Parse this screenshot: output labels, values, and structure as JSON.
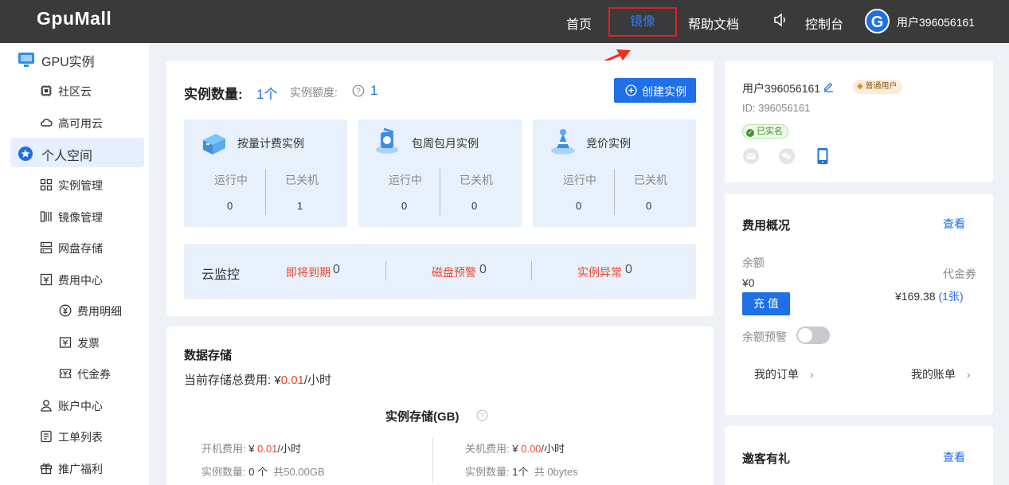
{
  "topbar": {
    "logo": "GpuMall",
    "nav": {
      "home": "首页",
      "mirror": "镜像",
      "docs": "帮助文档",
      "console": "控制台"
    },
    "user": "用户396056161",
    "avatar_letter": "G"
  },
  "sidebar": {
    "gpu_instance": "GPU实例",
    "community_cloud": "社区云",
    "ha_cloud": "高可用云",
    "personal_space": "个人空间",
    "instance_manage": "实例管理",
    "mirror_manage": "镜像管理",
    "disk_storage": "网盘存储",
    "fee_center": "费用中心",
    "fee_detail": "费用明细",
    "invoice": "发票",
    "voucher": "代金券",
    "account_center": "账户中心",
    "ticket_list": "工单列表",
    "promo": "推广福利"
  },
  "instances": {
    "count_label": "实例数量:",
    "count_value": "1个",
    "quota_label": "实例额度:",
    "quota_value": "1",
    "create_button": "创建实例",
    "cards": [
      {
        "title": "按量计费实例",
        "running_label": "运行中",
        "stopped_label": "已关机",
        "running": "0",
        "stopped": "1"
      },
      {
        "title": "包周包月实例",
        "running_label": "运行中",
        "stopped_label": "已关机",
        "running": "0",
        "stopped": "0"
      },
      {
        "title": "竞价实例",
        "running_label": "运行中",
        "stopped_label": "已关机",
        "running": "0",
        "stopped": "0"
      }
    ],
    "monitor": {
      "title": "云监控",
      "expiring_label": "即将到期",
      "expiring_value": "0",
      "disk_label": "磁盘预警",
      "disk_value": "0",
      "abnormal_label": "实例异常",
      "abnormal_value": "0"
    }
  },
  "storage": {
    "title": "数据存储",
    "total_label": "当前存储总费用:",
    "currency": "¥",
    "total_value": "0.01",
    "unit": "/小时",
    "instance_storage_title": "实例存储(GB)",
    "on_fee_label": "开机费用:",
    "on_fee_value": "0.01",
    "off_fee_label": "关机费用:",
    "off_fee_value": "0.00",
    "on_count_label": "实例数量:",
    "on_count_value": "0 个",
    "on_total": "共50.00GB",
    "off_count_label": "实例数量:",
    "off_count_value": "1个",
    "off_total": "共 0bytes"
  },
  "profile": {
    "name": "用户396056161",
    "level": "普通用户",
    "id": "ID: 396056161",
    "verified": "已实名"
  },
  "fees": {
    "title": "费用概况",
    "view": "查看",
    "balance_label": "余额",
    "balance_value": "¥0",
    "charge_button": "充 值",
    "voucher_label": "代金券",
    "voucher_value": "¥169.38",
    "voucher_count": "(1张)",
    "alert_label": "余额预警",
    "alert_enabled": false,
    "my_orders": "我的订单",
    "my_bills": "我的账单"
  },
  "invite": {
    "title": "邀客有礼",
    "view": "查看"
  },
  "colors": {
    "topbar": "#3a3a3a",
    "accent": "#1f6fe6",
    "highlight_border": "#e02020",
    "warning_text": "#e8482e"
  }
}
